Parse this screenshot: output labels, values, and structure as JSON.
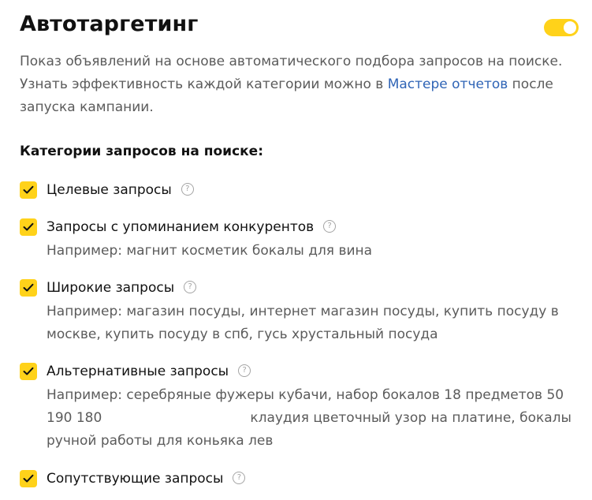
{
  "autotargeting": {
    "title": "Автотаргетинг",
    "enabled": true,
    "description": {
      "text_before_link": "Показ объявлений на основе автоматического подбора запросов на поиске. Узнать эффективность каждой категории можно в ",
      "link_text": "Мастере отчетов",
      "text_after_link": " после запуска кампании."
    }
  },
  "categories": {
    "title": "Категории запросов на поиске:",
    "help_symbol": "?",
    "items": [
      {
        "label": "Целевые запросы",
        "checked": true
      },
      {
        "label": "Запросы с упоминанием конкурентов",
        "checked": true,
        "example": "Например: магнит косметик бокалы для вина"
      },
      {
        "label": "Широкие запросы",
        "checked": true,
        "example": "Например: магазин посуды, интернет магазин посуды, купить посуду в москве, купить посуду в спб, гусь хрустальный посуда"
      },
      {
        "label": "Альтернативные запросы",
        "checked": true,
        "example_part1": "Например: серебряные фужеры кубачи, набор бокалов 18 предметов 50 190 180",
        "example_part2": "клаудия цветочный узор на платине, бокалы ручной работы для коньяка лев"
      },
      {
        "label": "Сопутствующие запросы",
        "checked": true
      }
    ]
  },
  "colors": {
    "accent_yellow": "#ffd21a",
    "link_blue": "#2f64b6",
    "secondary_text": "#5b5b5b",
    "primary_text": "#111111"
  }
}
